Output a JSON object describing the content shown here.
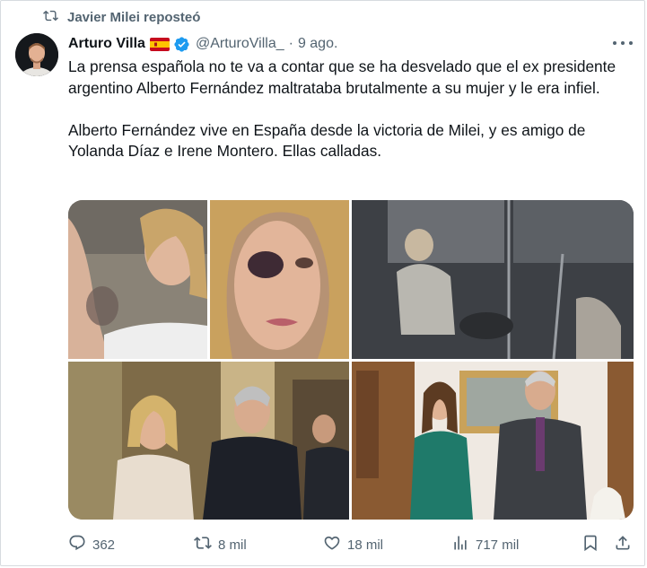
{
  "repost_label": "Javier Milei reposteó",
  "author": {
    "name": "Arturo Villa",
    "handle": "@ArturoVilla_",
    "date": "9 ago."
  },
  "tweet": {
    "paragraph1": "La prensa española no te va a contar que se ha desvelado que el ex presidente argentino Alberto Fernández maltrataba brutalmente a su mujer y le era infiel.",
    "paragraph2": "Alberto Fernández vive en España desde la victoria de Milei, y es amigo de Yolanda Díaz e Irene Montero. Ellas calladas."
  },
  "actions": {
    "replies": "362",
    "reposts": "8 mil",
    "likes": "18 mil",
    "views": "717 mil"
  },
  "icons": [
    "repost-icon",
    "flag-spain-icon",
    "verified-badge-icon",
    "more-icon",
    "reply-icon",
    "like-icon",
    "views-icon",
    "bookmark-icon",
    "share-icon"
  ],
  "colors": {
    "text": "#0f1419",
    "secondary": "#536471",
    "verified": "#1d9bf0"
  }
}
